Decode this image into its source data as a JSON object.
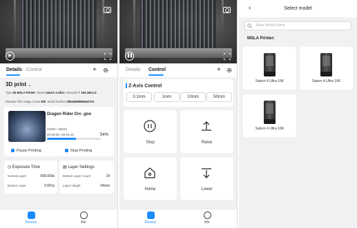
{
  "panel1": {
    "tabs": {
      "details": "Details",
      "control": "Control"
    },
    "section_title": "3D print",
    "info": {
      "type_label": "Type",
      "type_value": "3D MSLA Printer",
      "model_label": "Model",
      "model_value": "Saturn 4 Ultra",
      "ip_label": "Network IP",
      "ip_value": "192.168.1.0",
      "release_label": "Release Film Usage Count",
      "release_value": "300",
      "serial_label": "Serial Number",
      "serial_value": "29834569856452723"
    },
    "job": {
      "name": "Dragon Rider Orc .goo",
      "layer_info": "23355 / 45623",
      "time_info": "00:28:08 / 00:53:16",
      "progress_text": "54%",
      "progress": 0.54,
      "pause_label": "Pause Printing",
      "stop_label": "Stop Printing"
    },
    "exposure": {
      "title": "Exposure Time",
      "normal_label": "Normal Layer",
      "normal_value": "999.000s",
      "bottom_label": "Bottom Layer",
      "bottom_value": "0.001s"
    },
    "layer_settings": {
      "title": "Layer Settings",
      "bottom_count_label": "Bottom Layer Count",
      "bottom_count_value": "24",
      "height_label": "Layer Height",
      "height_value": "24mm"
    },
    "nav": {
      "device": "Device",
      "me": "Me"
    }
  },
  "panel2": {
    "tabs": {
      "details": "Details",
      "control": "Control"
    },
    "zaxis_title": "Z-Axis Control",
    "steps": [
      "0.1mm",
      "1mm",
      "10mm",
      "50mm"
    ],
    "buttons": {
      "stop": "Stop",
      "raise": "Raise",
      "home": "Home",
      "lower": "Lower"
    },
    "nav": {
      "device": "Device",
      "me": "Me"
    }
  },
  "panel3": {
    "title": "Select model",
    "search_placeholder": "Enter Model Name",
    "group_title": "MSLA Printer:",
    "models": [
      "Saturn 4 Ultra 16K",
      "Saturn 4 Ultra 16K",
      "Saturn 4 Ultra 16K"
    ]
  },
  "colors": {
    "accent": "#1a8cff",
    "background": "#f1f1f3"
  }
}
